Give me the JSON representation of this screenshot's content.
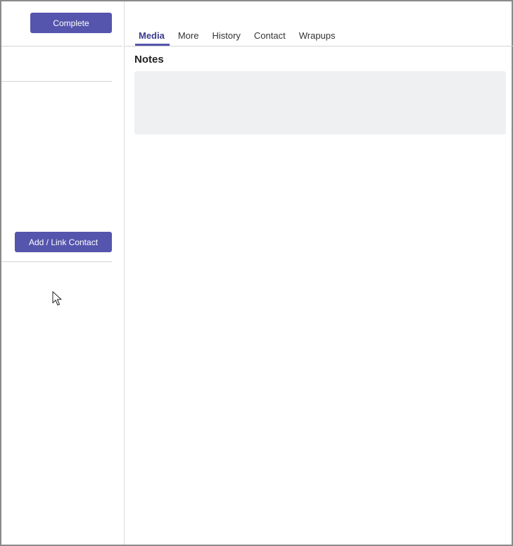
{
  "left_panel": {
    "complete_label": "Complete",
    "add_link_contact_label": "Add / Link Contact"
  },
  "tabs": [
    {
      "label": "Media",
      "active": true
    },
    {
      "label": "More",
      "active": false
    },
    {
      "label": "History",
      "active": false
    },
    {
      "label": "Contact",
      "active": false
    },
    {
      "label": "Wrapups",
      "active": false
    }
  ],
  "notes": {
    "title": "Notes",
    "value": ""
  },
  "colors": {
    "accent": "#5555ad",
    "notes_background": "#eff0f2"
  },
  "icons": {
    "mouse_pointer": "mouse-pointer-icon"
  }
}
